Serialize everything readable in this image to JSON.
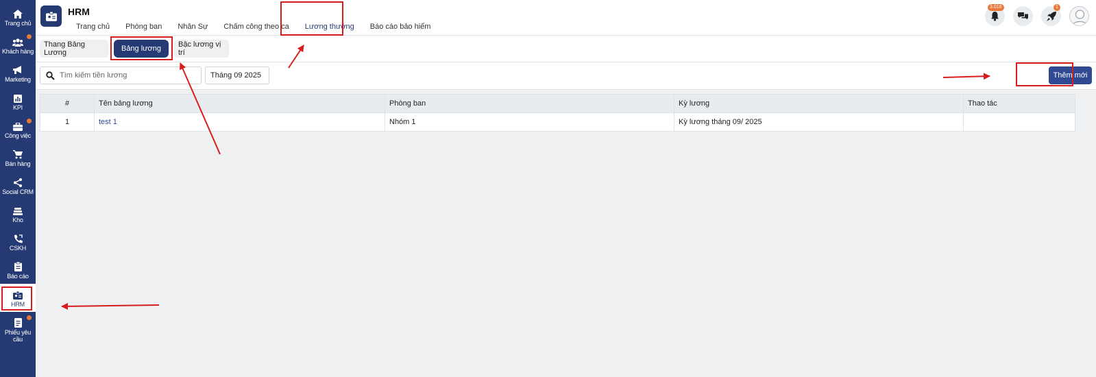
{
  "sidebar": {
    "items": [
      {
        "label": "Trang chủ",
        "icon": "home-icon",
        "dot": false
      },
      {
        "label": "Khách hàng",
        "icon": "users-icon",
        "dot": true
      },
      {
        "label": "Marketing",
        "icon": "megaphone-icon",
        "dot": false
      },
      {
        "label": "KPI",
        "icon": "chart-icon",
        "dot": false
      },
      {
        "label": "Công việc",
        "icon": "briefcase-icon",
        "dot": true
      },
      {
        "label": "Bán hàng",
        "icon": "cart-icon",
        "dot": false
      },
      {
        "label": "Social CRM",
        "icon": "share-icon",
        "dot": false
      },
      {
        "label": "Kho",
        "icon": "warehouse-icon",
        "dot": false
      },
      {
        "label": "CSKH",
        "icon": "phone-icon",
        "dot": false
      },
      {
        "label": "Báo cáo",
        "icon": "clipboard-icon",
        "dot": false
      },
      {
        "label": "HRM",
        "icon": "id-card-icon",
        "dot": false
      },
      {
        "label": "Phiếu yêu cầu",
        "icon": "document-icon",
        "dot": true
      }
    ]
  },
  "header": {
    "app_title": "HRM",
    "nav": [
      "Trang chủ",
      "Phòng ban",
      "Nhân Sự",
      "Chấm công theo ca",
      "Lương thưởng",
      "Báo cáo bảo hiểm"
    ],
    "notification_count": "3.016",
    "rocket_count": "1"
  },
  "subtabs": [
    "Thang Bảng Lương",
    "Bảng lương",
    "Bậc lương vị trí"
  ],
  "toolbar": {
    "search_placeholder": "Tìm kiếm tiền lương",
    "month": "Tháng 09 2025",
    "add_label": "Thêm mới"
  },
  "table": {
    "headers": [
      "#",
      "Tên bảng lương",
      "Phòng ban",
      "Kỳ lương",
      "Thao tác"
    ],
    "rows": [
      [
        "1",
        "test 1",
        "Nhóm 1",
        "Kỳ lương tháng 09/ 2025",
        ""
      ]
    ]
  },
  "colors": {
    "primary": "#253a73",
    "annotation": "#d91c1c",
    "badge": "#e8793a"
  }
}
